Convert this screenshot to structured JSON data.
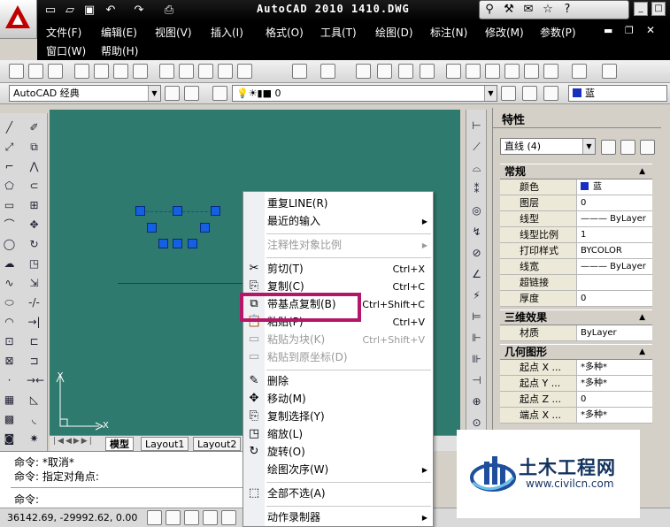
{
  "window": {
    "title": "AutoCAD 2010    1410.DWG"
  },
  "menus": [
    "文件(F)",
    "编辑(E)",
    "视图(V)",
    "插入(I)",
    "格式(O)",
    "工具(T)",
    "绘图(D)",
    "标注(N)",
    "修改(M)",
    "参数(P)",
    "窗口(W)",
    "帮助(H)"
  ],
  "toolbar": {
    "workspace": "AutoCAD 经典",
    "layer": "0",
    "color": "蓝"
  },
  "layout_tabs": [
    "模型",
    "Layout1",
    "Layout2"
  ],
  "command": {
    "line1": "命令: *取消*",
    "line2": "命令: 指定对角点:",
    "prompt": "命令:"
  },
  "status": {
    "coords": "36142.69, -29992.62, 0.00"
  },
  "properties": {
    "title": "特性",
    "selection": "直线 (4)",
    "sections": {
      "general": {
        "title": "常规",
        "rows": [
          {
            "k": "颜色",
            "v": "蓝"
          },
          {
            "k": "图层",
            "v": "0"
          },
          {
            "k": "线型",
            "v": "——— ByLayer"
          },
          {
            "k": "线型比例",
            "v": "1"
          },
          {
            "k": "打印样式",
            "v": "BYCOLOR"
          },
          {
            "k": "线宽",
            "v": "——— ByLayer"
          },
          {
            "k": "超链接",
            "v": ""
          },
          {
            "k": "厚度",
            "v": "0"
          }
        ]
      },
      "3d": {
        "title": "三维效果",
        "rows": [
          {
            "k": "材质",
            "v": "ByLayer"
          }
        ]
      },
      "geometry": {
        "title": "几何图形",
        "rows": [
          {
            "k": "起点 X ...",
            "v": "*多种*"
          },
          {
            "k": "起点 Y ...",
            "v": "*多种*"
          },
          {
            "k": "起点 Z ...",
            "v": "0"
          },
          {
            "k": "端点 X ...",
            "v": "*多种*"
          }
        ]
      }
    }
  },
  "context_menu": [
    {
      "label": "重复LINE(R)",
      "shortcut": "",
      "disabled": false,
      "sub": false,
      "icon": ""
    },
    {
      "label": "最近的输入",
      "shortcut": "",
      "disabled": false,
      "sub": true,
      "icon": ""
    },
    {
      "sep": true
    },
    {
      "label": "注释性对象比例",
      "shortcut": "",
      "disabled": true,
      "sub": true,
      "icon": ""
    },
    {
      "sep": true
    },
    {
      "label": "剪切(T)",
      "shortcut": "Ctrl+X",
      "disabled": false,
      "sub": false,
      "icon": "✂"
    },
    {
      "label": "复制(C)",
      "shortcut": "Ctrl+C",
      "disabled": false,
      "sub": false,
      "icon": "⎘"
    },
    {
      "label": "带基点复制(B)",
      "shortcut": "Ctrl+Shift+C",
      "disabled": false,
      "sub": false,
      "icon": "⧉"
    },
    {
      "label": "粘贴(P)",
      "shortcut": "Ctrl+V",
      "disabled": false,
      "sub": false,
      "icon": "📋"
    },
    {
      "label": "粘贴为块(K)",
      "shortcut": "Ctrl+Shift+V",
      "disabled": true,
      "sub": false,
      "icon": "▭"
    },
    {
      "label": "粘贴到原坐标(D)",
      "shortcut": "",
      "disabled": true,
      "sub": false,
      "icon": "▭"
    },
    {
      "sep": true
    },
    {
      "label": "删除",
      "shortcut": "",
      "disabled": false,
      "sub": false,
      "icon": "✎"
    },
    {
      "label": "移动(M)",
      "shortcut": "",
      "disabled": false,
      "sub": false,
      "icon": "✥"
    },
    {
      "label": "复制选择(Y)",
      "shortcut": "",
      "disabled": false,
      "sub": false,
      "icon": "⎘"
    },
    {
      "label": "缩放(L)",
      "shortcut": "",
      "disabled": false,
      "sub": false,
      "icon": "◳"
    },
    {
      "label": "旋转(O)",
      "shortcut": "",
      "disabled": false,
      "sub": false,
      "icon": "↻"
    },
    {
      "label": "绘图次序(W)",
      "shortcut": "",
      "disabled": false,
      "sub": true,
      "icon": ""
    },
    {
      "sep": true
    },
    {
      "label": "全部不选(A)",
      "shortcut": "",
      "disabled": false,
      "sub": false,
      "icon": "⬚"
    },
    {
      "sep": true
    },
    {
      "label": "动作录制器",
      "shortcut": "",
      "disabled": false,
      "sub": true,
      "icon": ""
    }
  ],
  "watermark": {
    "name": "土木工程网",
    "url": "www.civilcn.com"
  }
}
